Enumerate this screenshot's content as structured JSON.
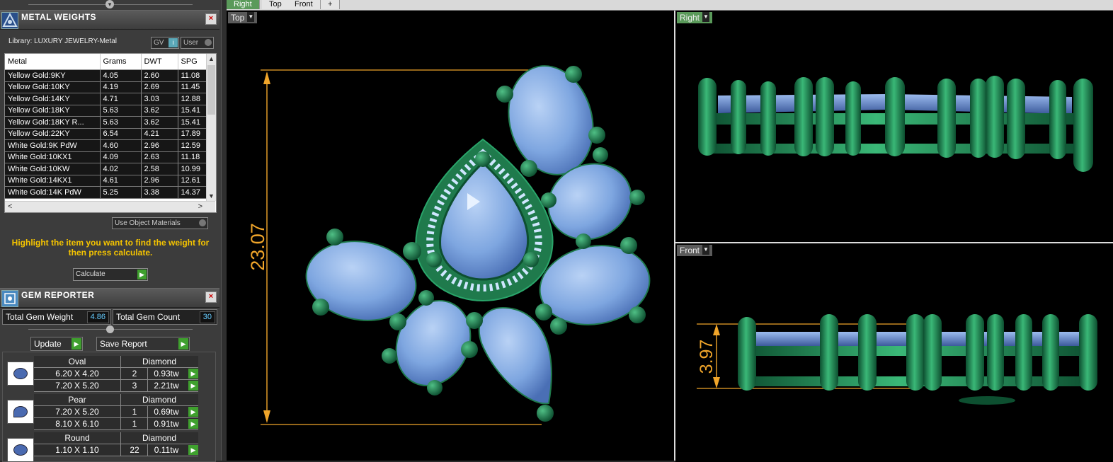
{
  "metal_weights": {
    "title": "METAL WEIGHTS",
    "library": "Library: LUXURY JEWELRY-Metal",
    "gv_label": "GV",
    "user_label": "User",
    "columns": [
      "Metal",
      "Grams",
      "DWT",
      "SPG"
    ],
    "rows": [
      [
        "Yellow Gold:9KY",
        "4.05",
        "2.60",
        "11.08"
      ],
      [
        "Yellow Gold:10KY",
        "4.19",
        "2.69",
        "11.45"
      ],
      [
        "Yellow Gold:14KY",
        "4.71",
        "3.03",
        "12.88"
      ],
      [
        "Yellow Gold:18KY",
        "5.63",
        "3.62",
        "15.41"
      ],
      [
        "Yellow Gold:18KY R...",
        "5.63",
        "3.62",
        "15.41"
      ],
      [
        "Yellow Gold:22KY",
        "6.54",
        "4.21",
        "17.89"
      ],
      [
        "White Gold:9K PdW",
        "4.60",
        "2.96",
        "12.59"
      ],
      [
        "White Gold:10KX1",
        "4.09",
        "2.63",
        "11.18"
      ],
      [
        "White Gold:10KW",
        "4.02",
        "2.58",
        "10.99"
      ],
      [
        "White Gold:14KX1",
        "4.61",
        "2.96",
        "12.61"
      ],
      [
        "White Gold:14K PdW",
        "5.25",
        "3.38",
        "14.37"
      ]
    ],
    "use_object_materials": "Use Object Materials",
    "hint": "Highlight the item you want to find the weight for then press calculate.",
    "calculate_label": "Calculate"
  },
  "gem_reporter": {
    "title": "GEM REPORTER",
    "total_weight_label": "Total Gem Weight",
    "total_weight_value": "4.86",
    "total_count_label": "Total Gem Count",
    "total_count_value": "30",
    "update_label": "Update",
    "save_report_label": "Save Report",
    "groups": [
      {
        "shape": "Oval",
        "material": "Diamond",
        "rows": [
          [
            "6.20 X 4.20",
            "2",
            "0.93tw"
          ],
          [
            "7.20 X 5.20",
            "3",
            "2.21tw"
          ]
        ]
      },
      {
        "shape": "Pear",
        "material": "Diamond",
        "rows": [
          [
            "7.20 X 5.20",
            "1",
            "0.69tw"
          ],
          [
            "8.10 X 6.10",
            "1",
            "0.91tw"
          ]
        ]
      },
      {
        "shape": "Round",
        "material": "Diamond",
        "rows": [
          [
            "1.10 X 1.10",
            "22",
            "0.11tw"
          ]
        ]
      }
    ]
  },
  "viewport_tabs": [
    "Right",
    "Top",
    "Front",
    "+"
  ],
  "viewports": {
    "top": {
      "label": "Top",
      "dimension": "23.07"
    },
    "right": {
      "label": "Right"
    },
    "front": {
      "label": "Front",
      "dimension": "3.97"
    }
  },
  "colors": {
    "gem": "#7ea6e0",
    "metal": "#1f7a4c",
    "dimension": "#f0a52a",
    "hint": "#f5c400",
    "accent_green": "#3fa02e"
  }
}
